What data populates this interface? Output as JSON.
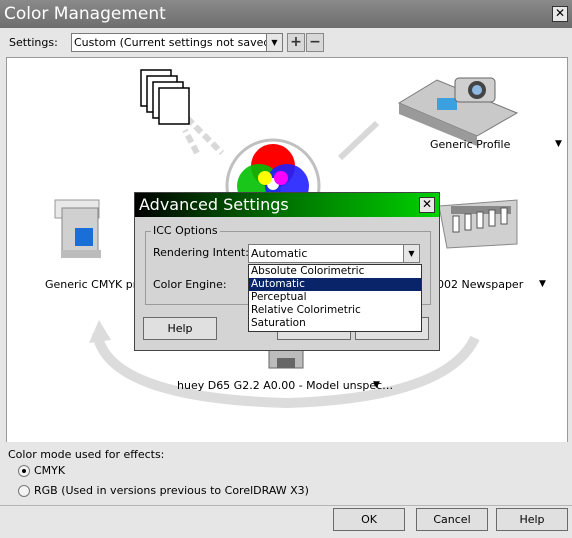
{
  "window": {
    "title": "Color Management"
  },
  "settings": {
    "label": "Settings:",
    "value": "Custom (Current settings not saved)"
  },
  "devices": {
    "generic_profile": "Generic Profile",
    "cmyk_printer": "Generic CMYK printer",
    "newspaper": "002 Newspaper",
    "monitor": "huey D65 G2.2 A0.00 - Model unspec…"
  },
  "effects": {
    "heading": "Color mode used for effects:",
    "options": [
      {
        "label": "CMYK",
        "selected": true
      },
      {
        "label": "RGB (Used in versions previous to CorelDRAW X3)",
        "selected": false
      }
    ]
  },
  "buttons": {
    "ok": "OK",
    "cancel": "Cancel",
    "help": "Help"
  },
  "advanced": {
    "title": "Advanced Settings",
    "group_label": "ICC Options",
    "rendering_intent_label": "Rendering Intent:",
    "rendering_intent_value": "Automatic",
    "color_engine_label": "Color Engine:",
    "help": "Help",
    "dropdown_options": [
      "Absolute Colorimetric",
      "Automatic",
      "Perceptual",
      "Relative Colorimetric",
      "Saturation"
    ],
    "selected_index": 1
  },
  "colors": {
    "title_green_start": "#000000",
    "title_green_end": "#00d200",
    "selection": "#0a246a"
  }
}
